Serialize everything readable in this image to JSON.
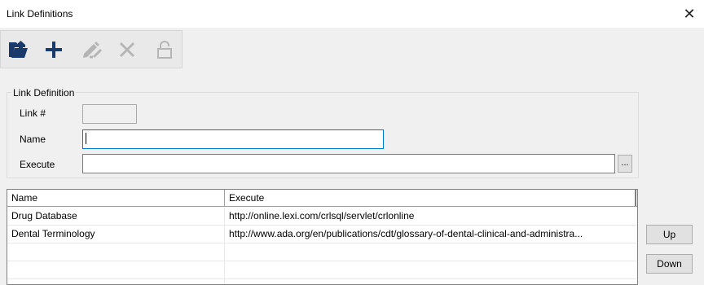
{
  "window": {
    "title": "Link Definitions",
    "close_glyph": "✕"
  },
  "toolbar": {
    "buttons": [
      {
        "name": "open-icon",
        "enabled": true
      },
      {
        "name": "add-icon",
        "enabled": true
      },
      {
        "name": "edit-icon",
        "enabled": false
      },
      {
        "name": "delete-icon",
        "enabled": false
      },
      {
        "name": "lock-icon",
        "enabled": false
      }
    ]
  },
  "form": {
    "group_label": "Link Definition",
    "link_no_label": "Link #",
    "link_no_value": "",
    "name_label": "Name",
    "name_value": "",
    "execute_label": "Execute",
    "execute_value": "",
    "browse_label": "..."
  },
  "grid": {
    "columns": [
      "Name",
      "Execute"
    ],
    "rows": [
      {
        "name": "Drug Database",
        "execute": "http://online.lexi.com/crlsql/servlet/crlonline"
      },
      {
        "name": "Dental Terminology",
        "execute": "http://www.ada.org/en/publications/cdt/glossary-of-dental-clinical-and-administra..."
      },
      {
        "name": "",
        "execute": ""
      },
      {
        "name": "",
        "execute": ""
      },
      {
        "name": "",
        "execute": ""
      }
    ]
  },
  "side": {
    "up_label": "Up",
    "down_label": "Down"
  },
  "colors": {
    "icon_active": "#1a3a6b",
    "icon_disabled": "#b5b5b5",
    "focus_border": "#0078d7"
  }
}
